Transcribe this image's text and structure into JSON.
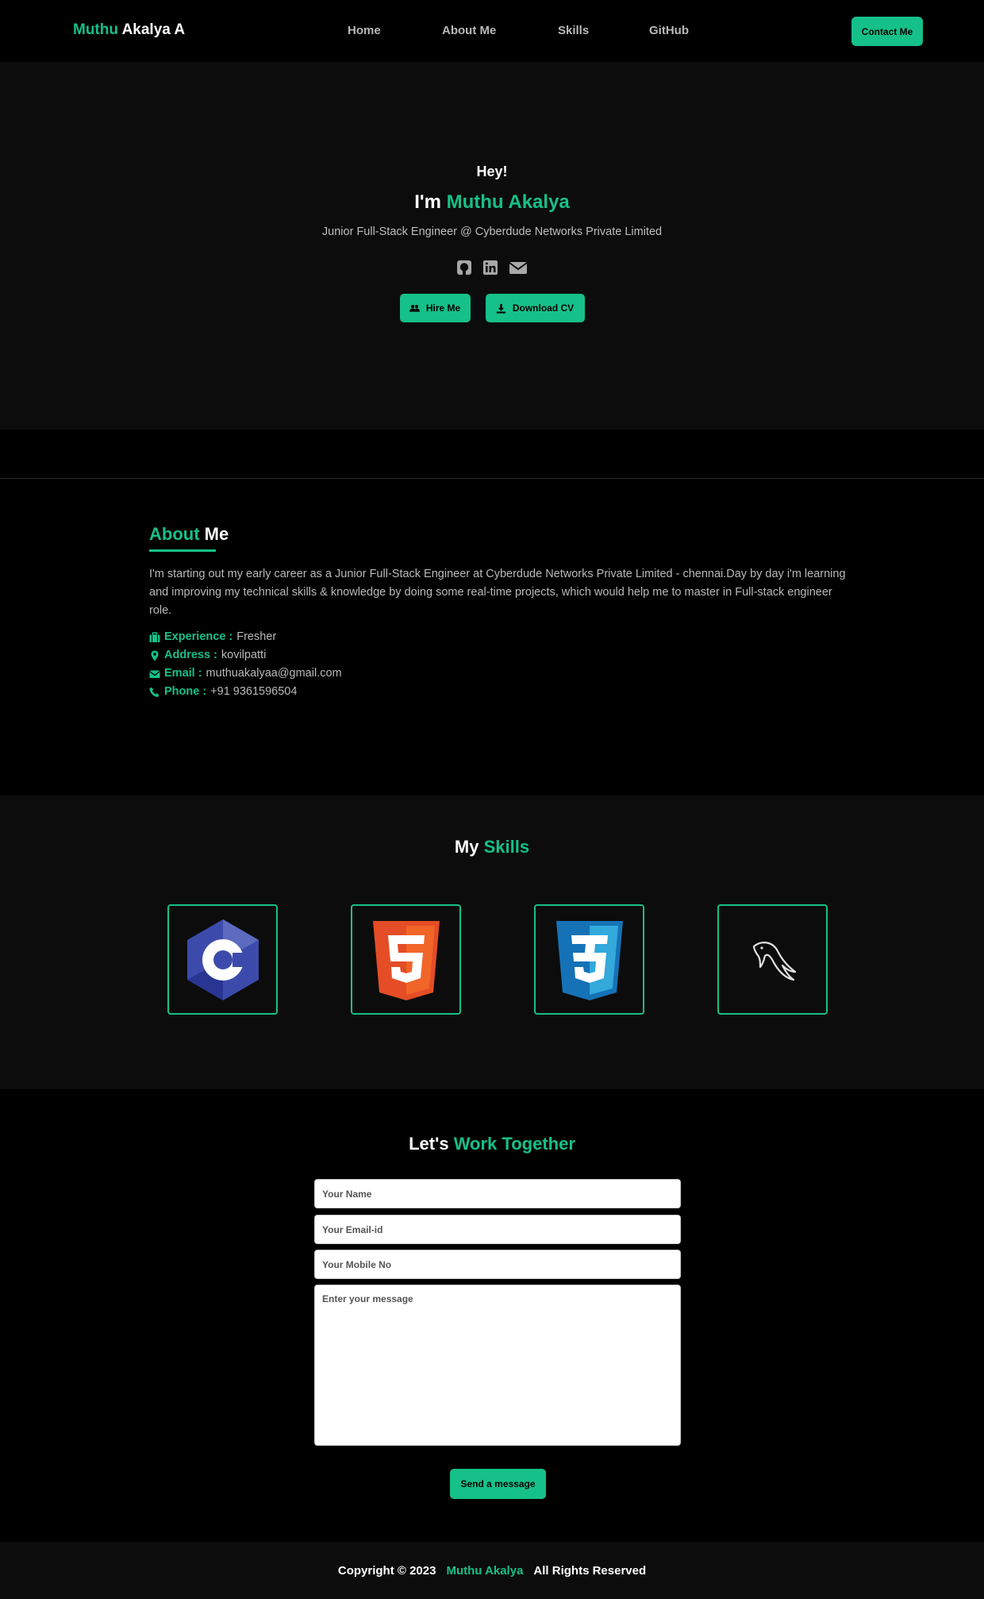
{
  "nav": {
    "brand_first": "Muthu",
    "brand_rest": "Akalya A",
    "links": [
      "Home",
      "About Me",
      "Skills",
      "GitHub"
    ],
    "contact_label": "Contact Me"
  },
  "hero": {
    "greeting": "Hey!",
    "name_prefix": "I'm",
    "name": "Muthu Akalya",
    "subtitle": "Junior Full-Stack Engineer @ Cyberdude Networks Private Limited",
    "icons": [
      "github-icon",
      "linkedin-icon",
      "envelope-icon"
    ],
    "hire_label": "Hire Me",
    "cv_label": "Download CV"
  },
  "about": {
    "title_accent": "About",
    "title_rest": "Me",
    "text": "I'm starting out my early career as a Junior Full-Stack Engineer at Cyberdude Networks Private Limited - chennai.Day by day i'm learning and improving my technical skills & knowledge by doing some real-time projects, which would help me to master in Full-stack engineer role.",
    "info": [
      {
        "icon": "briefcase-icon",
        "label": "Experience :",
        "value": "Fresher"
      },
      {
        "icon": "map-marker-icon",
        "label": "Address :",
        "value": "kovilpatti"
      },
      {
        "icon": "envelope-icon",
        "label": "Email :",
        "value": "muthuakalyaa@gmail.com"
      },
      {
        "icon": "phone-icon",
        "label": "Phone :",
        "value": "+91 9361596504"
      }
    ]
  },
  "skills": {
    "title_first": "My",
    "title_accent": "Skills",
    "items": [
      "c-logo-icon",
      "html5-logo-icon",
      "css3-logo-icon",
      "mysql-dolphin-icon"
    ]
  },
  "contact": {
    "title_first": "Let's",
    "title_accent": "Work Together",
    "name_placeholder": "Your Name",
    "email_placeholder": "Your Email-id",
    "mobile_placeholder": "Your Mobile No",
    "message_placeholder": "Enter your message",
    "send_label": "Send a message"
  },
  "footer": {
    "copyright": "Copyright © 2023",
    "name": "Muthu Akalya",
    "rights": "All Rights Reserved"
  },
  "colors": {
    "accent": "#16c089",
    "background": "#000000",
    "section_alt": "#0c0c0c"
  }
}
